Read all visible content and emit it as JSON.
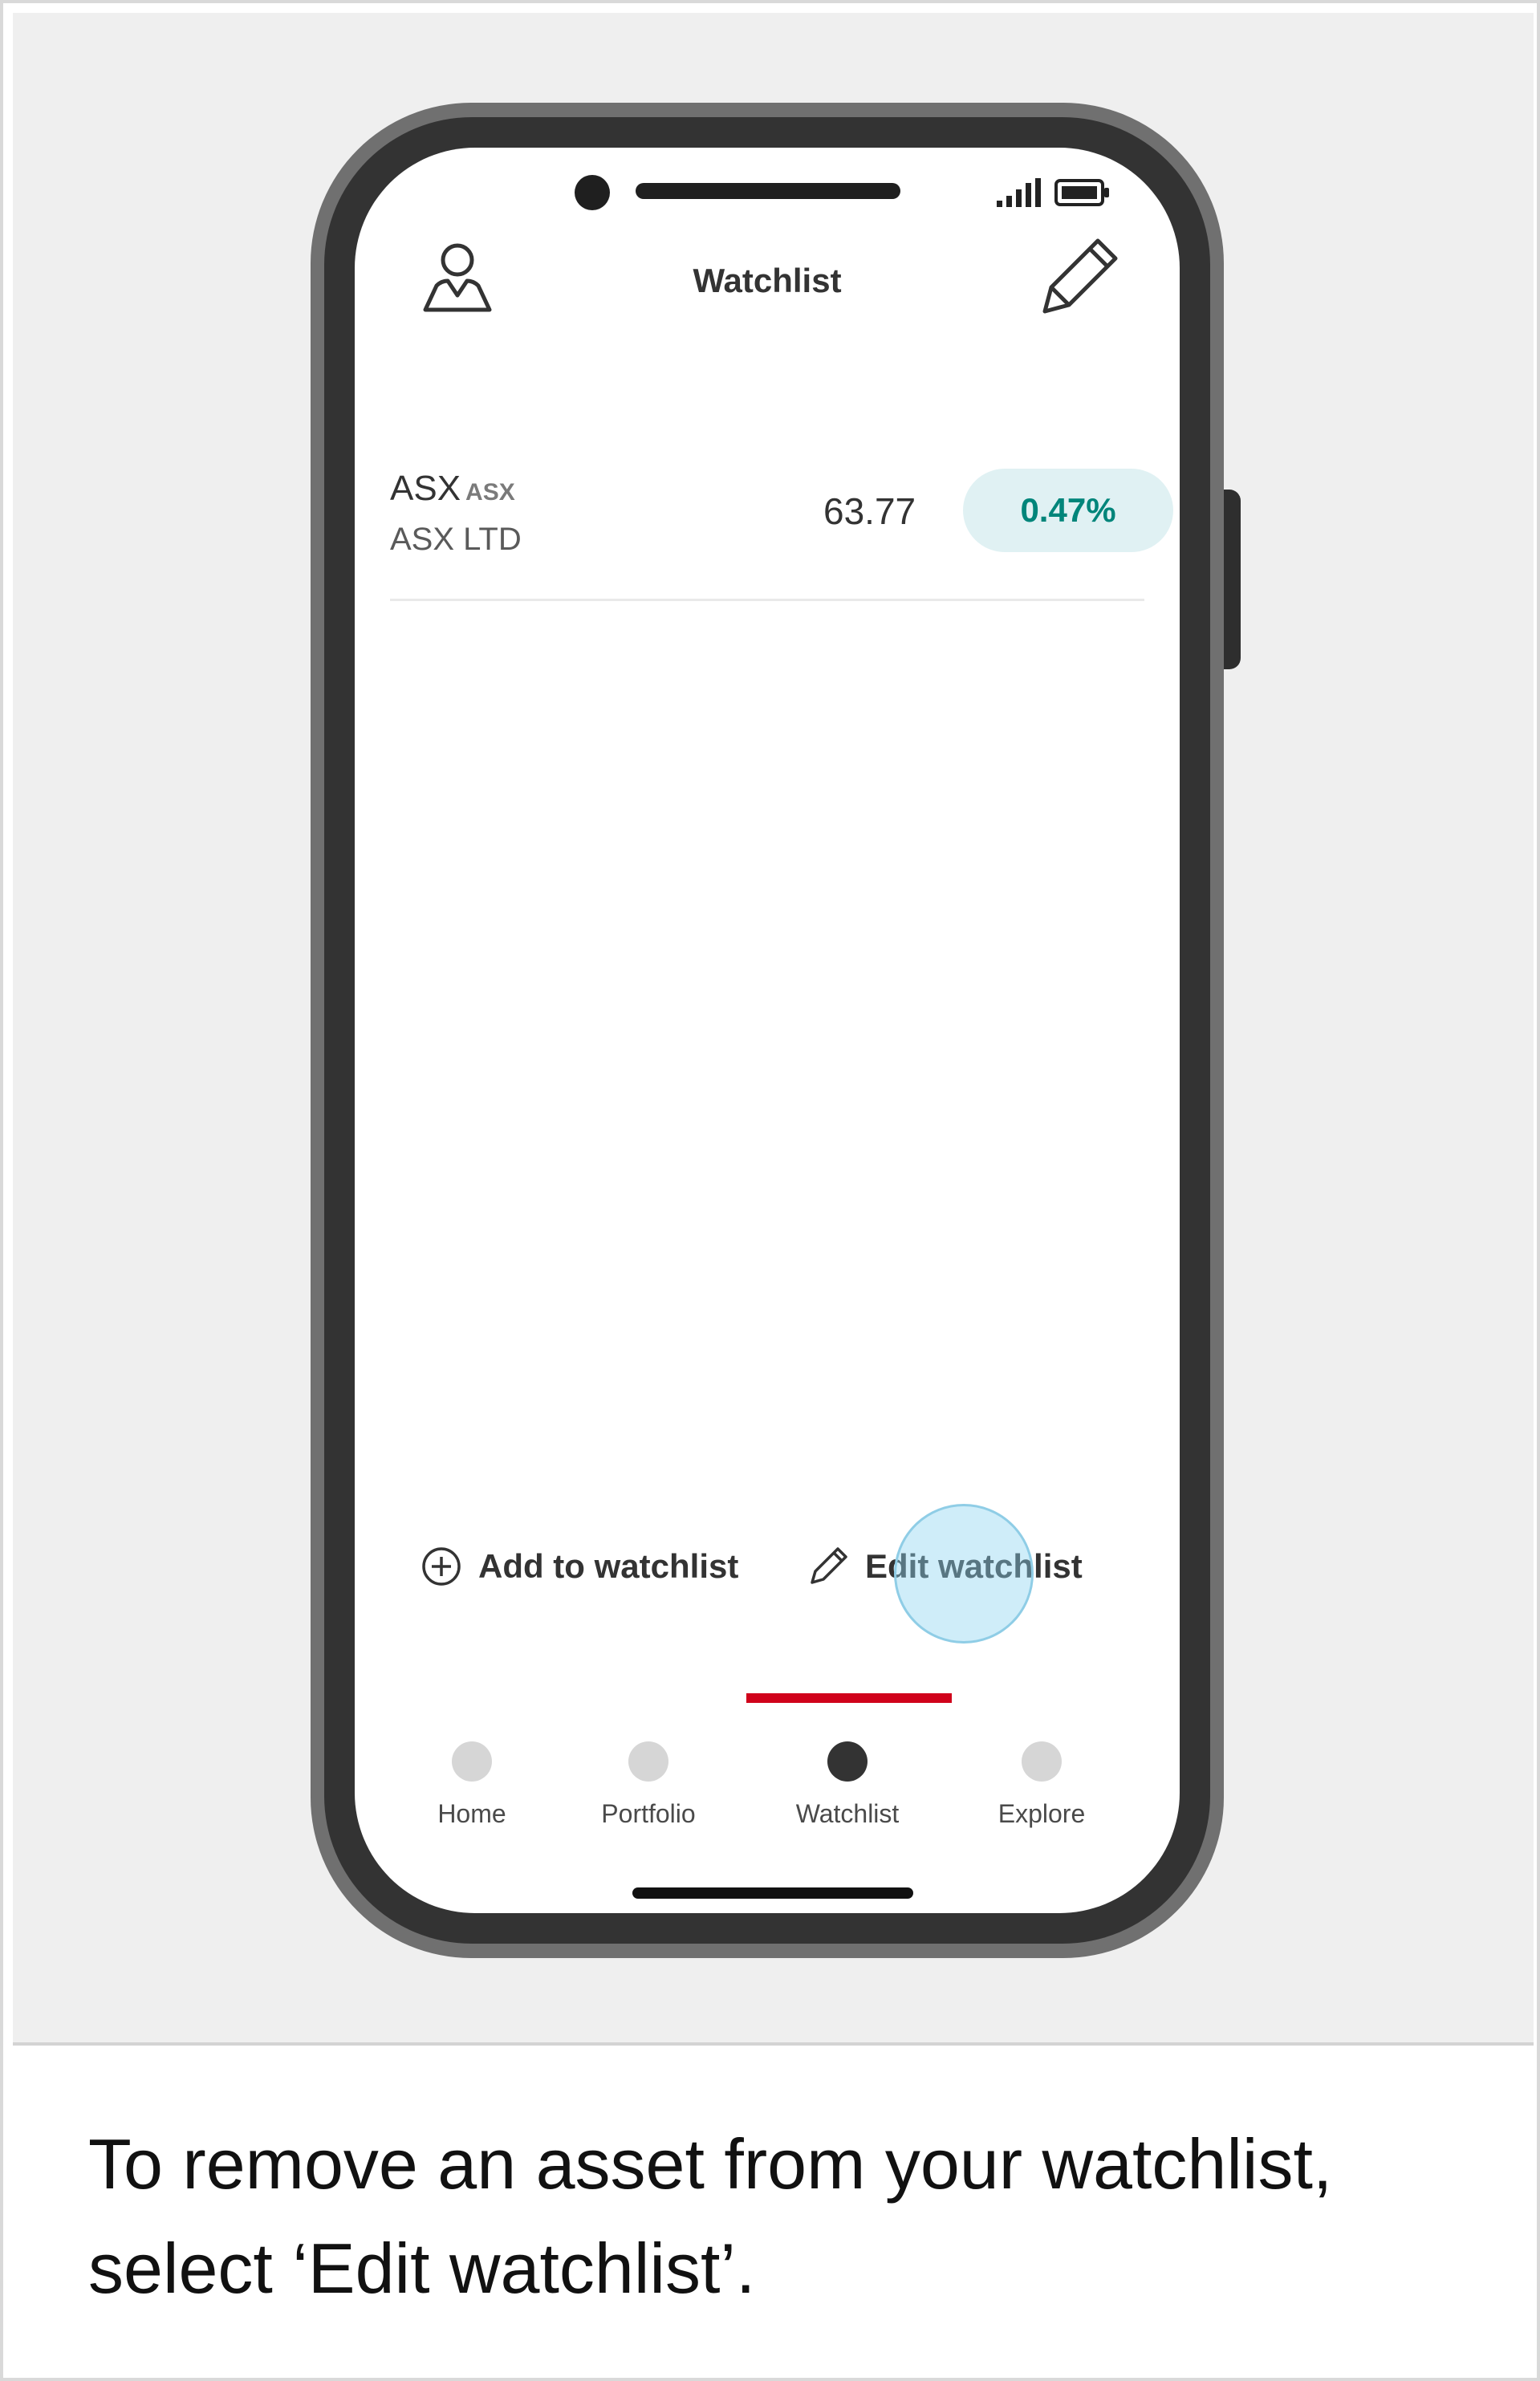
{
  "header": {
    "title": "Watchlist"
  },
  "icons": {
    "profile": "profile-icon",
    "edit": "pencil-icon",
    "add": "plus-circle-icon",
    "signal": "signal-icon",
    "battery": "battery-icon"
  },
  "watchlist": {
    "items": [
      {
        "code": "ASX",
        "exchange": "ASX",
        "name": "ASX LTD",
        "price": "63.77",
        "change": "0.47%"
      }
    ]
  },
  "actions": {
    "add_label": "Add to watchlist",
    "edit_label": "Edit watchlist"
  },
  "nav": {
    "items": [
      {
        "label": "Home"
      },
      {
        "label": "Portfolio"
      },
      {
        "label": "Watchlist"
      },
      {
        "label": "Explore"
      }
    ],
    "active": "Watchlist"
  },
  "caption": "To remove an asset from your watchlist, select ‘Edit watchlist’.",
  "colors": {
    "accent": "#d0021b",
    "positive_text": "#00857a",
    "positive_bg": "#e0f1f3",
    "tap_indicator": "#8cd4f0"
  }
}
